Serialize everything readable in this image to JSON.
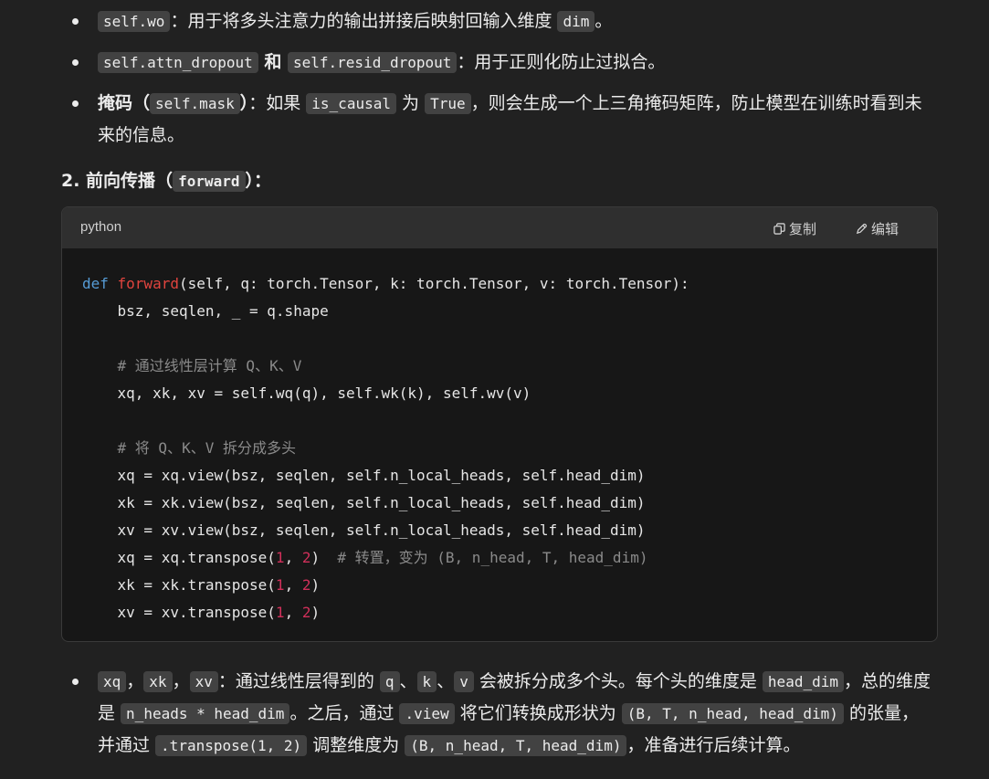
{
  "list1": [
    {
      "parts": [
        {
          "t": "code",
          "v": "self.wo"
        },
        {
          "t": "text",
          "v": "：用于将多头注意力的输出拼接后映射回输入维度 "
        },
        {
          "t": "code",
          "v": "dim"
        },
        {
          "t": "text",
          "v": "。"
        }
      ]
    },
    {
      "parts": [
        {
          "t": "code",
          "v": "self.attn_dropout"
        },
        {
          "t": "bold",
          "v": " 和 "
        },
        {
          "t": "code",
          "v": "self.resid_dropout"
        },
        {
          "t": "text",
          "v": "：用于正则化防止过拟合。"
        }
      ]
    },
    {
      "parts": [
        {
          "t": "bold",
          "v": "掩码（"
        },
        {
          "t": "code",
          "v": "self.mask"
        },
        {
          "t": "bold",
          "v": "）"
        },
        {
          "t": "text",
          "v": "：如果 "
        },
        {
          "t": "code",
          "v": "is_causal"
        },
        {
          "t": "text",
          "v": " 为 "
        },
        {
          "t": "code",
          "v": "True"
        },
        {
          "t": "text",
          "v": "，则会生成一个上三角掩码矩阵，防止模型在训练时看到未来的信息。"
        }
      ]
    }
  ],
  "heading": {
    "prefix": "2. 前向传播（",
    "code": "forward",
    "suffix": "）："
  },
  "codeblock": {
    "language": "python",
    "copy_label": "复制",
    "edit_label": "编辑",
    "lines": [
      [
        {
          "c": "kw",
          "v": "def "
        },
        {
          "c": "fn",
          "v": "forward"
        },
        {
          "c": "",
          "v": "(self, q: torch.Tensor, k: torch.Tensor, v: torch.Tensor):"
        }
      ],
      [
        {
          "c": "",
          "v": "    bsz, seqlen, _ = q.shape"
        }
      ],
      [],
      [
        {
          "c": "cm",
          "v": "    # 通过线性层计算 Q、K、V"
        }
      ],
      [
        {
          "c": "",
          "v": "    xq, xk, xv = self.wq(q), self.wk(k), self.wv(v)"
        }
      ],
      [],
      [
        {
          "c": "cm",
          "v": "    # 将 Q、K、V 拆分成多头"
        }
      ],
      [
        {
          "c": "",
          "v": "    xq = xq.view(bsz, seqlen, self.n_local_heads, self.head_dim)"
        }
      ],
      [
        {
          "c": "",
          "v": "    xk = xk.view(bsz, seqlen, self.n_local_heads, self.head_dim)"
        }
      ],
      [
        {
          "c": "",
          "v": "    xv = xv.view(bsz, seqlen, self.n_local_heads, self.head_dim)"
        }
      ],
      [
        {
          "c": "",
          "v": "    xq = xq.transpose("
        },
        {
          "c": "num",
          "v": "1"
        },
        {
          "c": "",
          "v": ", "
        },
        {
          "c": "num",
          "v": "2"
        },
        {
          "c": "",
          "v": ")  "
        },
        {
          "c": "cm",
          "v": "# 转置，变为 (B, n_head, T, head_dim)"
        }
      ],
      [
        {
          "c": "",
          "v": "    xk = xk.transpose("
        },
        {
          "c": "num",
          "v": "1"
        },
        {
          "c": "",
          "v": ", "
        },
        {
          "c": "num",
          "v": "2"
        },
        {
          "c": "",
          "v": ")"
        }
      ],
      [
        {
          "c": "",
          "v": "    xv = xv.transpose("
        },
        {
          "c": "num",
          "v": "1"
        },
        {
          "c": "",
          "v": ", "
        },
        {
          "c": "num",
          "v": "2"
        },
        {
          "c": "",
          "v": ")"
        }
      ]
    ]
  },
  "list2": [
    {
      "parts": [
        {
          "t": "code",
          "v": "xq"
        },
        {
          "t": "text",
          "v": "，"
        },
        {
          "t": "code",
          "v": "xk"
        },
        {
          "t": "text",
          "v": "，"
        },
        {
          "t": "code",
          "v": "xv"
        },
        {
          "t": "text",
          "v": "：通过线性层得到的 "
        },
        {
          "t": "code",
          "v": "q"
        },
        {
          "t": "text",
          "v": "、"
        },
        {
          "t": "code",
          "v": "k"
        },
        {
          "t": "text",
          "v": "、"
        },
        {
          "t": "code",
          "v": "v"
        },
        {
          "t": "text",
          "v": " 会被拆分成多个头。每个头的维度是 "
        },
        {
          "t": "code",
          "v": "head_dim"
        },
        {
          "t": "text",
          "v": "，总的维度是 "
        },
        {
          "t": "code",
          "v": "n_heads * head_dim"
        },
        {
          "t": "text",
          "v": "。之后，通过 "
        },
        {
          "t": "code",
          "v": ".view"
        },
        {
          "t": "text",
          "v": " 将它们转换成形状为 "
        },
        {
          "t": "code",
          "v": "(B, T, n_head, head_dim)"
        },
        {
          "t": "text",
          "v": " 的张量，并通过 "
        },
        {
          "t": "code",
          "v": ".transpose(1, 2)"
        },
        {
          "t": "text",
          "v": " 调整维度为 "
        },
        {
          "t": "code",
          "v": "(B, n_head, T, head_dim)"
        },
        {
          "t": "text",
          "v": "，准备进行后续计算。"
        }
      ]
    }
  ]
}
